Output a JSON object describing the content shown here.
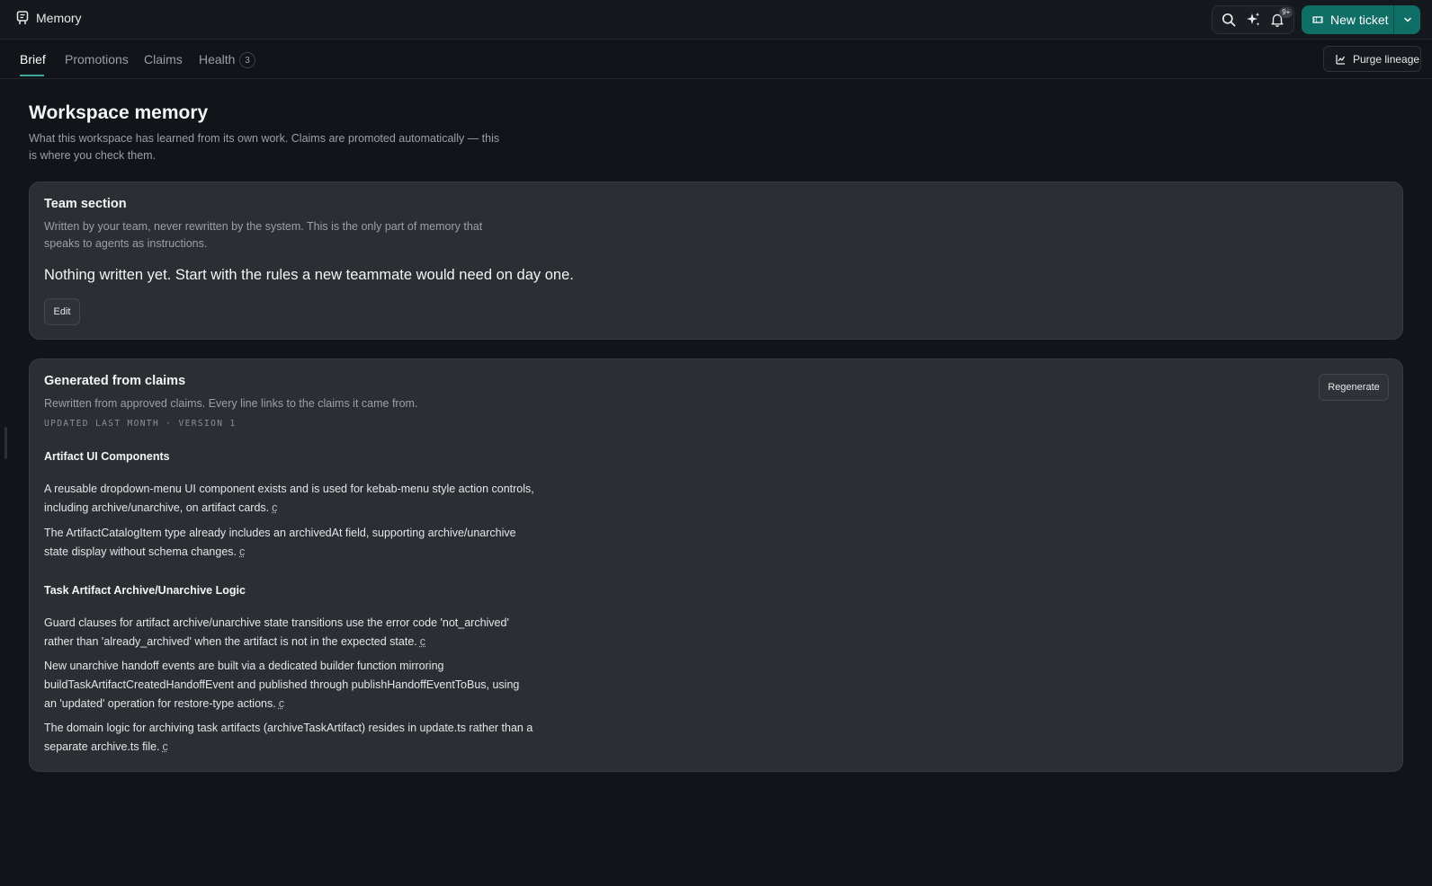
{
  "header": {
    "app_title": "Memory",
    "notification_badge": "9+",
    "new_ticket_label": "New ticket",
    "icons": [
      "memory-icon",
      "search-icon",
      "sparkles-icon",
      "bell-icon",
      "ticket-icon",
      "chevron-down-icon"
    ]
  },
  "tabs": {
    "items": [
      {
        "label": "Brief",
        "active": true
      },
      {
        "label": "Promotions",
        "active": false
      },
      {
        "label": "Claims",
        "active": false
      },
      {
        "label": "Health",
        "active": false
      }
    ],
    "health_count": "3",
    "purge_label": "Purge lineage"
  },
  "page": {
    "title": "Workspace memory",
    "description": "What this workspace has learned from its own work. Claims are promoted automatically — this is where you check them."
  },
  "team_section": {
    "title": "Team section",
    "description": "Written by your team, never rewritten by the system. This is the only part of memory that speaks to agents as instructions.",
    "empty_message": "Nothing written yet. Start with the rules a new teammate would need on day one.",
    "edit_label": "Edit"
  },
  "generated_section": {
    "title": "Generated from claims",
    "description": "Rewritten from approved claims. Every line links to the claims it came from.",
    "meta": "UPDATED LAST MONTH · VERSION 1",
    "regenerate_label": "Regenerate",
    "groups": [
      {
        "heading": "Artifact UI Components",
        "claims": [
          {
            "text": "A reusable dropdown-menu UI component exists and is used for kebab-menu style action controls, including archive/unarchive, on artifact cards.",
            "cite": "c"
          },
          {
            "text": "The ArtifactCatalogItem type already includes an archivedAt field, supporting archive/unarchive state display without schema changes.",
            "cite": "c"
          }
        ]
      },
      {
        "heading": "Task Artifact Archive/Unarchive Logic",
        "claims": [
          {
            "text": "Guard clauses for artifact archive/unarchive state transitions use the error code 'not_archived' rather than 'already_archived' when the artifact is not in the expected state.",
            "cite": "c"
          },
          {
            "text": "New unarchive handoff events are built via a dedicated builder function mirroring buildTaskArtifactCreatedHandoffEvent and published through publishHandoffEventToBus, using an 'updated' operation for restore-type actions.",
            "cite": "c"
          },
          {
            "text": "The domain logic for archiving task artifacts (archiveTaskArtifact) resides in update.ts rather than a separate archive.ts file.",
            "cite": "c"
          }
        ]
      }
    ]
  },
  "colors": {
    "accent": "#0f6f66",
    "tab_underline": "#3ea89c",
    "background": "#111418",
    "card": "#2b2f33"
  }
}
